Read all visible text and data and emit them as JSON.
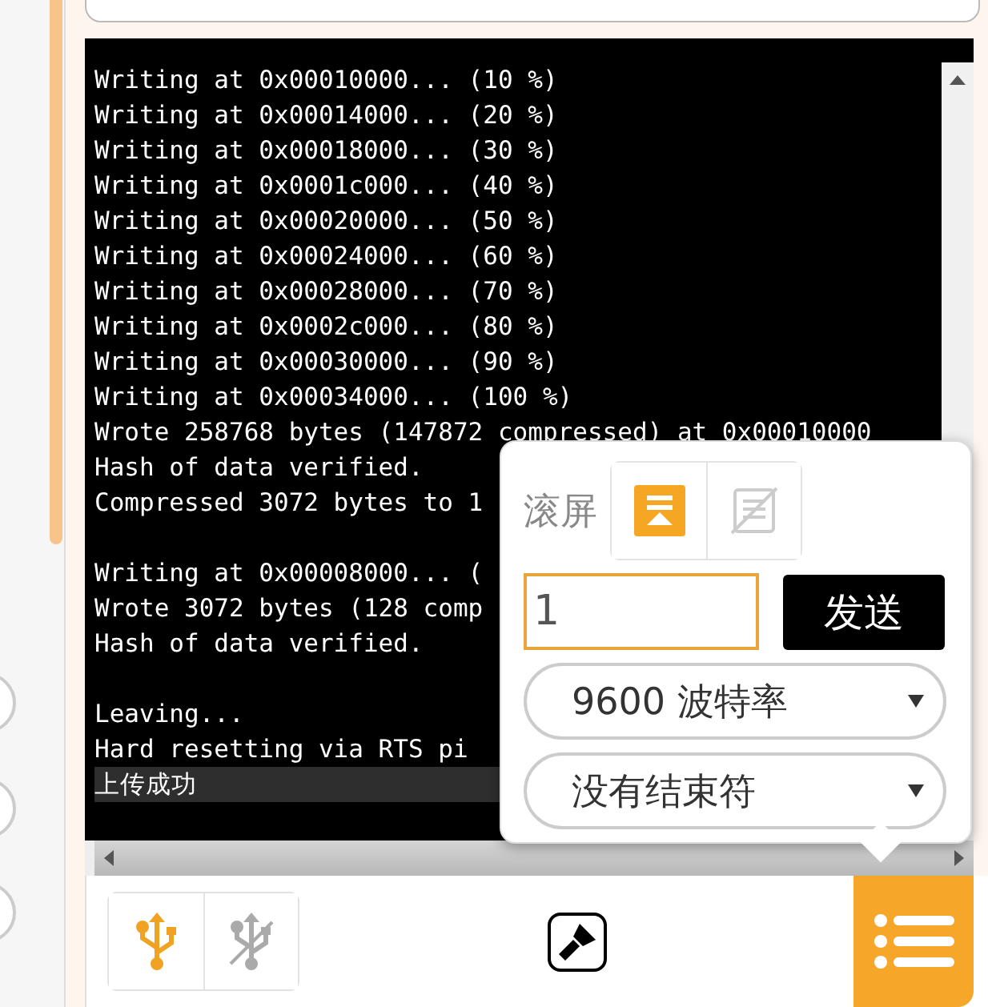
{
  "console": {
    "lines": [
      {
        "kind": "text",
        "text": "Writing at 0x00010000... (10 %)",
        "highlighted": false
      },
      {
        "kind": "text",
        "text": "Writing at 0x00014000... (20 %)",
        "highlighted": false
      },
      {
        "kind": "text",
        "text": "Writing at 0x00018000... (30 %)",
        "highlighted": false
      },
      {
        "kind": "text",
        "text": "Writing at 0x0001c000... (40 %)",
        "highlighted": false
      },
      {
        "kind": "text",
        "text": "Writing at 0x00020000... (50 %)",
        "highlighted": false
      },
      {
        "kind": "text",
        "text": "Writing at 0x00024000... (60 %)",
        "highlighted": false
      },
      {
        "kind": "text",
        "text": "Writing at 0x00028000... (70 %)",
        "highlighted": false
      },
      {
        "kind": "text",
        "text": "Writing at 0x0002c000... (80 %)",
        "highlighted": false
      },
      {
        "kind": "text",
        "text": "Writing at 0x00030000... (90 %)",
        "highlighted": false
      },
      {
        "kind": "text",
        "text": "Writing at 0x00034000... (100 %)",
        "highlighted": false
      },
      {
        "kind": "text",
        "text": "Wrote 258768 bytes (147872 compressed) at 0x00010000",
        "highlighted": false
      },
      {
        "kind": "text",
        "text": "Hash of data verified.",
        "highlighted": false
      },
      {
        "kind": "text",
        "text": "Compressed 3072 bytes to 1",
        "highlighted": false
      },
      {
        "kind": "blank"
      },
      {
        "kind": "text",
        "text": "Writing at 0x00008000... (",
        "highlighted": false
      },
      {
        "kind": "text",
        "text": "Wrote 3072 bytes (128 comp",
        "highlighted": false
      },
      {
        "kind": "text",
        "text": "Hash of data verified.",
        "highlighted": false
      },
      {
        "kind": "blank"
      },
      {
        "kind": "text",
        "text": "Leaving...",
        "highlighted": false
      },
      {
        "kind": "text",
        "text": "Hard resetting via RTS pi",
        "highlighted": false
      },
      {
        "kind": "text",
        "text": "上传成功",
        "highlighted": true
      }
    ]
  },
  "serial_panel": {
    "scroll_label": "滚屏",
    "scroll_modes": [
      {
        "kind": "autoscroll",
        "selected": true
      },
      {
        "kind": "no-scroll",
        "selected": false
      }
    ],
    "input": {
      "value": "1"
    },
    "send_button": "发送",
    "baud_select": "9600 波特率",
    "line_ending_select": "没有结束符"
  },
  "toolbar": {
    "usb_buttons": [
      {
        "kind": "connect",
        "active": true
      },
      {
        "kind": "disconnect",
        "active": false
      }
    ],
    "menu_button": {
      "active": true
    }
  }
}
